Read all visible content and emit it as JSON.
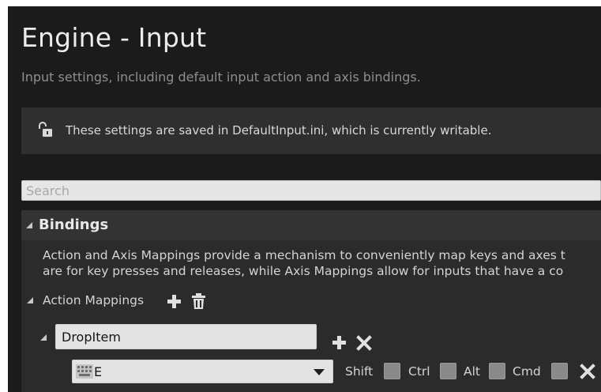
{
  "header": {
    "title": "Engine - Input",
    "subtitle": "Input settings, including default input action and axis bindings."
  },
  "notice": {
    "icon": "unlocked-padlock-icon",
    "text": "These settings are saved in DefaultInput.ini, which is currently writable."
  },
  "search": {
    "placeholder": "Search",
    "value": ""
  },
  "bindings": {
    "title": "Bindings",
    "description_line1": "Action and Axis Mappings provide a mechanism to conveniently map keys and axes t",
    "description_line2": "are for key presses and releases, while Axis Mappings allow for inputs that have a co",
    "action_mappings": {
      "label": "Action Mappings",
      "add_icon": "plus-icon",
      "delete_icon": "trash-icon",
      "items": [
        {
          "name": "DropItem",
          "add_icon": "plus-icon",
          "remove_icon": "x-icon",
          "keys": [
            {
              "key": "E",
              "modifiers": [
                {
                  "label": "Shift",
                  "checked": false
                },
                {
                  "label": "Ctrl",
                  "checked": false
                },
                {
                  "label": "Alt",
                  "checked": false
                },
                {
                  "label": "Cmd",
                  "checked": false
                }
              ],
              "remove_icon": "x-icon"
            }
          ]
        }
      ]
    }
  },
  "colors": {
    "background": "#1b1b1b",
    "panel": "#2b2b2b",
    "section_header": "#333333",
    "notice_bg": "#2f2f2f",
    "text": "#d4d4d4",
    "field_bg": "#e3e3e3"
  }
}
